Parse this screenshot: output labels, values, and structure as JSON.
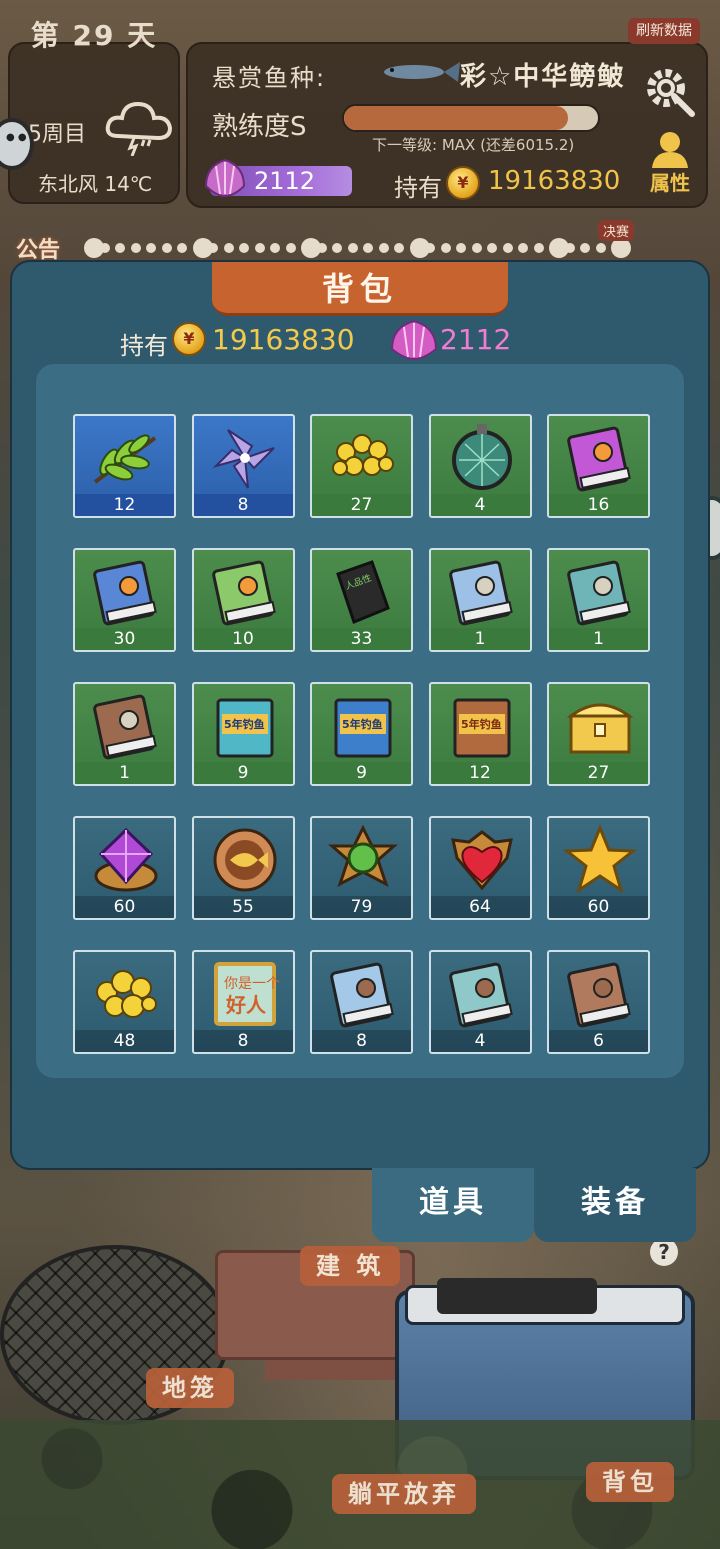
{
  "hud": {
    "day": "第 29 天",
    "week": "5周目",
    "weather_icon": "thunderstorm-cloud-icon",
    "wind": "东北风 14℃",
    "refresh": "刷新数据",
    "bounty_label": "悬赏鱼种:",
    "bounty_fish": "彩☆中华鳑鲏",
    "skill": "熟练度S",
    "skill_progress": 0.88,
    "next_level": "下一等级: MAX (还差6015.2)",
    "attr": "属性",
    "shells": "2112",
    "hold": "持有",
    "coins": "19163830"
  },
  "notice": {
    "label": "公告",
    "final": "决赛"
  },
  "backpack": {
    "title": "背包",
    "hold": "持有",
    "coins": "19163830",
    "shells": "2112",
    "items": [
      {
        "icon": "leaf-branch-icon",
        "count": "12",
        "bg": "blue"
      },
      {
        "icon": "purple-flower-icon",
        "count": "8",
        "bg": "blue"
      },
      {
        "icon": "corn-bait-icon",
        "count": "27",
        "bg": "green"
      },
      {
        "icon": "fishing-net-icon",
        "count": "4",
        "bg": "green"
      },
      {
        "icon": "purple-book-3-icon",
        "count": "16",
        "bg": "green"
      },
      {
        "icon": "blue-book-2-icon",
        "count": "30",
        "bg": "green"
      },
      {
        "icon": "green-book-1-icon",
        "count": "10",
        "bg": "green"
      },
      {
        "icon": "black-bottle-icon",
        "count": "33",
        "bg": "green"
      },
      {
        "icon": "mid-manual-blue-icon",
        "count": "1",
        "bg": "green"
      },
      {
        "icon": "mid-manual-teal-icon",
        "count": "1",
        "bg": "green"
      },
      {
        "icon": "mid-manual-brown-icon",
        "count": "1",
        "bg": "green"
      },
      {
        "icon": "exam-book-teal-icon",
        "count": "9",
        "bg": "green"
      },
      {
        "icon": "exam-book-blue-icon",
        "count": "9",
        "bg": "green"
      },
      {
        "icon": "exam-book-brown-icon",
        "count": "12",
        "bg": "green"
      },
      {
        "icon": "gold-chest-icon",
        "count": "27",
        "bg": "green"
      },
      {
        "icon": "purple-gem-icon",
        "count": "60",
        "bg": "teal"
      },
      {
        "icon": "fish-medal-icon",
        "count": "55",
        "bg": "teal"
      },
      {
        "icon": "green-gem-icon",
        "count": "79",
        "bg": "teal"
      },
      {
        "icon": "heart-gem-icon",
        "count": "64",
        "bg": "teal"
      },
      {
        "icon": "gold-star-icon",
        "count": "60",
        "bg": "teal"
      },
      {
        "icon": "gold-nugget-icon",
        "count": "48",
        "bg": "teal"
      },
      {
        "icon": "good-person-card-icon",
        "count": "8",
        "bg": "teal"
      },
      {
        "icon": "basic-manual-blue-icon",
        "count": "8",
        "bg": "teal"
      },
      {
        "icon": "basic-manual-teal-icon",
        "count": "4",
        "bg": "teal"
      },
      {
        "icon": "basic-manual-brown-icon",
        "count": "6",
        "bg": "teal"
      }
    ],
    "tabs": [
      {
        "label": "道具",
        "active": true
      },
      {
        "label": "装备",
        "active": false
      }
    ]
  },
  "scene_labels": {
    "building": "建 筑",
    "cage": "地笼",
    "giveup": "躺平放弃",
    "bag": "背包"
  },
  "colors": {
    "modal": "#2f5a6e",
    "title_tab": "#c7632f",
    "coin_text": "#f2c94c",
    "shell_text": "#f07dd0"
  }
}
